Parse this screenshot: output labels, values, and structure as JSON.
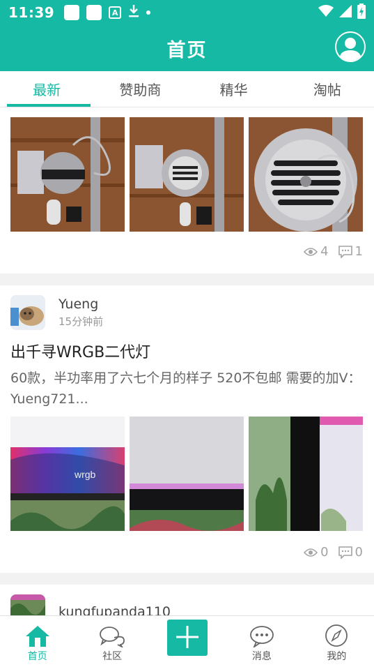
{
  "status_bar": {
    "time": "11:39",
    "a_badge": "A"
  },
  "header": {
    "title": "首页"
  },
  "tabs": [
    {
      "label": "最新",
      "active": true
    },
    {
      "label": "赞助商",
      "active": false
    },
    {
      "label": "精华",
      "active": false
    },
    {
      "label": "淘帖",
      "active": false
    }
  ],
  "posts": [
    {
      "views": "4",
      "comments": "1"
    },
    {
      "username": "Yueng",
      "time": "15分钟前",
      "title": "出千寻WRGB二代灯",
      "excerpt": "60款，半功率用了六七个月的样子  520不包邮  需要的加V：Yueng721...",
      "views": "0",
      "comments": "0",
      "photo_text": "wrgb"
    },
    {
      "username": "kungfupanda110"
    }
  ],
  "bottom_nav": [
    {
      "label": "首页",
      "active": true
    },
    {
      "label": "社区",
      "active": false
    },
    {
      "label": "",
      "active": false
    },
    {
      "label": "消息",
      "active": false
    },
    {
      "label": "我的",
      "active": false
    }
  ],
  "colors": {
    "accent": "#16b9a4",
    "stat": "#a3a3a3"
  },
  "icons": [
    "wifi-icon",
    "signal-icon",
    "battery-icon",
    "download-icon",
    "profile-icon",
    "eye-icon",
    "comment-icon",
    "home-icon",
    "community-icon",
    "plus-icon",
    "message-icon",
    "compass-icon"
  ]
}
